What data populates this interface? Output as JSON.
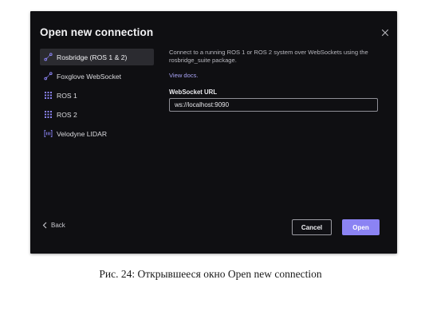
{
  "dialog": {
    "title": "Open new connection",
    "sources": [
      {
        "label": "Rosbridge (ROS 1 & 2)",
        "icon": "connection-icon",
        "active": true
      },
      {
        "label": "Foxglove WebSocket",
        "icon": "connection-icon",
        "active": false
      },
      {
        "label": "ROS 1",
        "icon": "grid-dots-icon",
        "active": false
      },
      {
        "label": "ROS 2",
        "icon": "grid-dots-icon",
        "active": false
      },
      {
        "label": "Velodyne LIDAR",
        "icon": "lidar-icon",
        "active": false
      }
    ],
    "description": "Connect to a running ROS 1 or ROS 2 system over WebSockets using the rosbridge_suite package.",
    "docs_link": "View docs.",
    "field_label": "WebSocket URL",
    "field_value": "ws://localhost:9090",
    "back_label": "Back",
    "cancel_label": "Cancel",
    "open_label": "Open"
  },
  "caption": "Рис. 24: Открывшееся окно Open new connection",
  "colors": {
    "dialog_bg": "#0f0f12",
    "active_item_bg": "#2b2b30",
    "accent": "#8b83f3",
    "link": "#a8a3f5"
  }
}
